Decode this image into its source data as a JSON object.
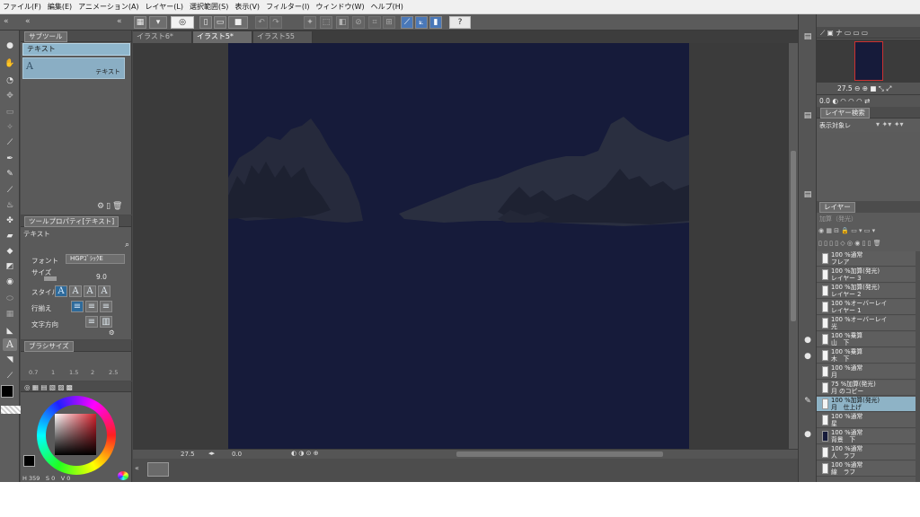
{
  "menu": [
    "ファイル(F)",
    "編集(E)",
    "アニメーション(A)",
    "レイヤー(L)",
    "選択範囲(S)",
    "表示(V)",
    "フィルター(I)",
    "ウィンドウ(W)",
    "ヘルプ(H)"
  ],
  "doc_tabs": [
    "イラスト6*",
    "イラスト5*",
    "イラスト55"
  ],
  "subtool": {
    "tab": "サブツール",
    "selected": "テキスト",
    "item_label": "テキスト"
  },
  "toolprop": {
    "tab": "ツールプロパティ[テキスト]",
    "name": "テキスト",
    "font_label": "フォント",
    "font_value": "HGPｺﾞｼｯｸE",
    "size_label": "サイズ",
    "size_value": "9.0",
    "style_label": "スタイル",
    "align_label": "行揃え",
    "dir_label": "文字方向"
  },
  "brushsize": {
    "tab": "ブラシサイズ",
    "ticks": [
      "0.7",
      "1",
      "1.5",
      "2",
      "2.5"
    ]
  },
  "color_readout": {
    "h": "359",
    "s": "0",
    "v": "0"
  },
  "status": {
    "zoom": "27.5",
    "angle": "0.0"
  },
  "navigator": {
    "zoom": "27.5",
    "angle": "0.0"
  },
  "layer_search": {
    "tab": "レイヤー検索",
    "filter": "表示対象レ"
  },
  "layer_panel": {
    "tab": "レイヤー",
    "blend": "加算（発光）"
  },
  "layers": [
    {
      "l1": "100 %通常",
      "l2": "フレア",
      "eye": false,
      "selected": false
    },
    {
      "l1": "100 %加算(発光)",
      "l2": "レイヤー 3",
      "eye": false,
      "selected": false
    },
    {
      "l1": "100 %加算(発光)",
      "l2": "レイヤー 2",
      "eye": false,
      "selected": false
    },
    {
      "l1": "100 %オーバーレイ",
      "l2": "レイヤー 1",
      "eye": false,
      "selected": false
    },
    {
      "l1": "100 %オーバーレイ",
      "l2": "光",
      "eye": false,
      "selected": false
    },
    {
      "l1": "100 %乗算",
      "l2": "山　下",
      "eye": true,
      "selected": false
    },
    {
      "l1": "100 %乗算",
      "l2": "木　下",
      "eye": true,
      "selected": false
    },
    {
      "l1": "100 %通常",
      "l2": "月",
      "eye": false,
      "selected": false
    },
    {
      "l1": "75 %加算(発光)",
      "l2": "月 のコピー",
      "eye": false,
      "selected": false
    },
    {
      "l1": "100 %加算(発光)",
      "l2": "月　仕上げ",
      "eye": false,
      "selected": true
    },
    {
      "l1": "100 %通常",
      "l2": "星",
      "eye": false,
      "selected": false
    },
    {
      "l1": "100 %通常",
      "l2": "背景　下",
      "eye": true,
      "selected": false
    },
    {
      "l1": "100 %通常",
      "l2": "人　ラフ",
      "eye": false,
      "selected": false
    },
    {
      "l1": "100 %通常",
      "l2": "線　ラフ",
      "eye": false,
      "selected": false
    }
  ],
  "colors": {
    "artboard": "#161b3a",
    "silhouette": "#2a2f3c",
    "accent": "#8eb3c6"
  }
}
